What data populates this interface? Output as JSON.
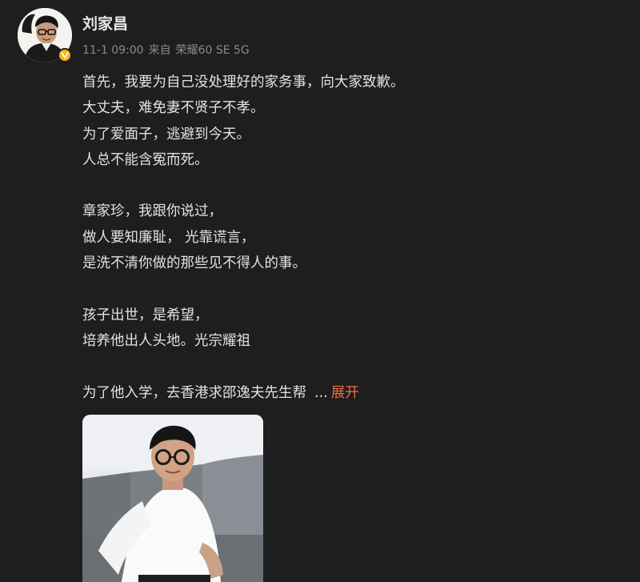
{
  "post": {
    "author": "刘家昌",
    "meta": {
      "time": "11-1 09:00",
      "source_prefix": "来自",
      "device": "荣耀60 SE 5G"
    },
    "paragraphs": [
      [
        "首先，我要为自己没处理好的家务事，向大家致歉。",
        "大丈夫，难免妻不贤子不孝。",
        "为了爱面子，逃避到今天。",
        "人总不能含冤而死。"
      ],
      [
        "章家珍，我跟你说过，",
        "做人要知廉耻， 光靠谎言，",
        "是洗不清你做的那些见不得人的事。"
      ],
      [
        "孩子出世，是希望，",
        "培养他出人头地。光宗耀祖"
      ]
    ],
    "last_line": "为了他入学，去香港求邵逸夫先生帮",
    "ellipsis": "...",
    "expand_label": "展开"
  },
  "colors": {
    "background": "#1e1e1e",
    "text": "#e2e2e2",
    "meta": "#8a8a8a",
    "link": "#f26d3b",
    "verified_badge": "#f6b41c"
  },
  "icons": {
    "verified": "verified-badge-icon"
  }
}
